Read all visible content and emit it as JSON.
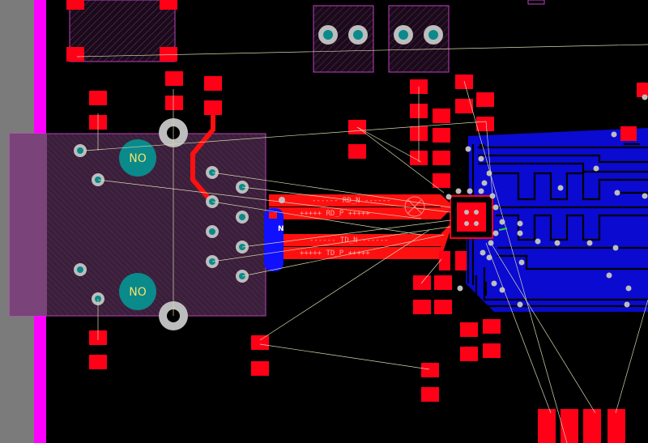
{
  "view": {
    "title": "",
    "colors": {
      "background": "#000000",
      "edge_gray": "#7b7b7b",
      "board_outline": "#ff00ff",
      "component_body": "#6b3f6b",
      "pad_red": "#ff0017",
      "trace_red": "#ff1010",
      "bottom_layer": "#1010ff",
      "via_ring": "#bdbdbd",
      "via_hole": "#0a8a8a",
      "ratsnest": "#d8d8b0",
      "label_yellow": "#f6e26a"
    }
  },
  "labels": {
    "rd_n": "------ RD_N ------",
    "rd_p": "+++++ RD_P +++++",
    "td_n": "------ TD_N ------",
    "td_p": "+++++ TD_P +++++",
    "no_top": "NO",
    "no_bottom": "NO",
    "n_marker": "N"
  }
}
